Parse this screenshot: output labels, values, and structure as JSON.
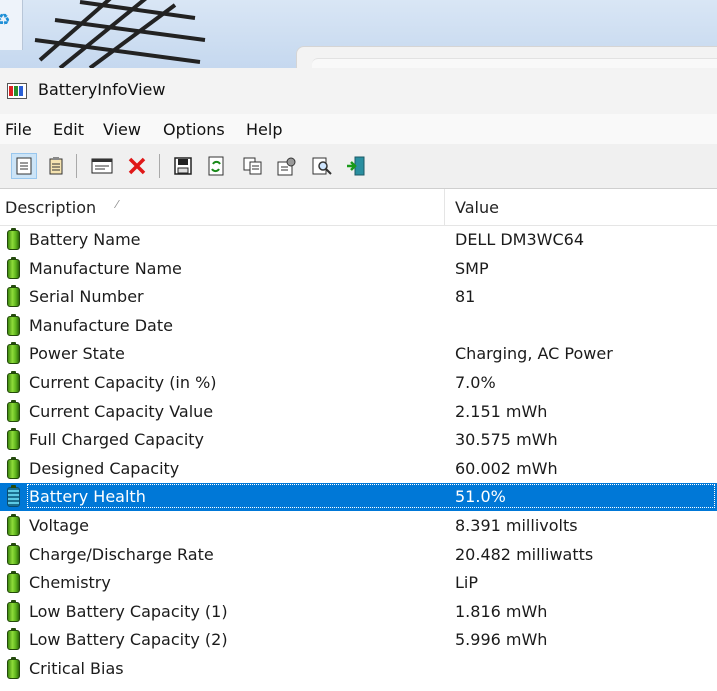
{
  "window": {
    "title": "BatteryInfoView",
    "accent": "#0078d7"
  },
  "menu": [
    "File",
    "Edit",
    "View",
    "Options",
    "Help"
  ],
  "toolbar": [
    {
      "icon": "html-report-selected-icon",
      "pressed": true
    },
    {
      "icon": "html-report-all-icon"
    },
    {
      "icon": "properties-window-icon"
    },
    {
      "icon": "delete-red-x-icon"
    },
    {
      "icon": "save-floppy-icon"
    },
    {
      "icon": "refresh-icon"
    },
    {
      "icon": "copy-icon"
    },
    {
      "icon": "advanced-options-icon"
    },
    {
      "icon": "find-magnifier-icon"
    },
    {
      "icon": "exit-door-icon"
    }
  ],
  "list": {
    "columns": [
      "Description",
      "Value"
    ],
    "sort_indicator": "⁄",
    "rows": [
      {
        "desc": "Battery Name",
        "val": "DELL DM3WC64"
      },
      {
        "desc": "Manufacture Name",
        "val": "SMP"
      },
      {
        "desc": "Serial Number",
        "val": "81"
      },
      {
        "desc": "Manufacture Date",
        "val": ""
      },
      {
        "desc": "Power State",
        "val": "Charging, AC Power"
      },
      {
        "desc": "Current Capacity (in %)",
        "val": "7.0%"
      },
      {
        "desc": "Current Capacity Value",
        "val": "2.151 mWh"
      },
      {
        "desc": "Full Charged Capacity",
        "val": "30.575 mWh"
      },
      {
        "desc": "Designed Capacity",
        "val": "60.002 mWh"
      },
      {
        "desc": "Battery Health",
        "val": "51.0%",
        "selected": true
      },
      {
        "desc": "Voltage",
        "val": "8.391 millivolts"
      },
      {
        "desc": "Charge/Discharge Rate",
        "val": "20.482 milliwatts"
      },
      {
        "desc": "Chemistry",
        "val": "LiP"
      },
      {
        "desc": "Low Battery Capacity (1)",
        "val": "1.816 mWh"
      },
      {
        "desc": "Low Battery Capacity (2)",
        "val": "5.996 mWh"
      },
      {
        "desc": "Critical Bias",
        "val": ""
      }
    ]
  }
}
